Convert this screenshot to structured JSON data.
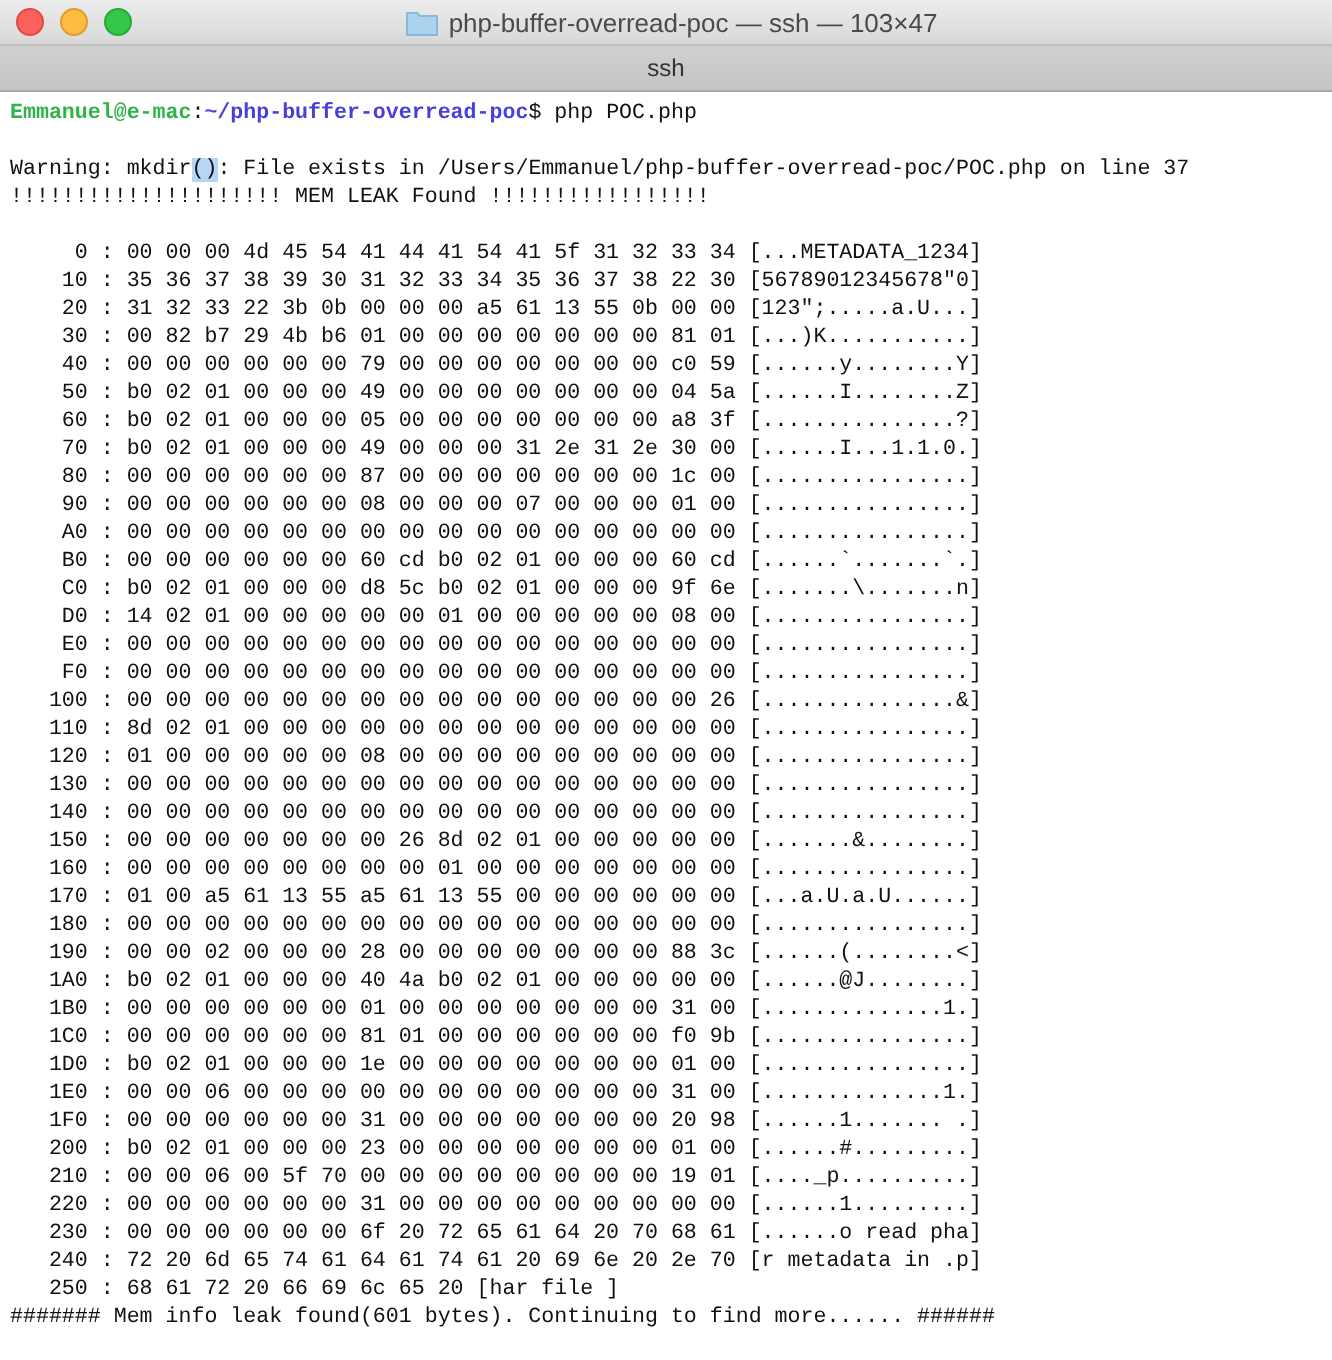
{
  "window": {
    "title": "php-buffer-overread-poc — ssh — 103×47"
  },
  "tab": {
    "label": "ssh"
  },
  "prompt": {
    "user_host": "Emmanuel@e-mac",
    "separator": ":",
    "path": "~/php-buffer-overread-poc",
    "command": "$ php POC.php"
  },
  "warning": [
    {
      "text": "Warning: mkdir",
      "selected": false
    },
    {
      "text": "()",
      "selected": true
    },
    {
      "text": ": File exists in /Users/Emmanuel/php-buffer-overread-poc/POC.php on line 37",
      "selected": false
    }
  ],
  "banner": "!!!!!!!!!!!!!!!!!!!!! MEM LEAK Found !!!!!!!!!!!!!!!!!",
  "dump": [
    "     0 : 00 00 00 4d 45 54 41 44 41 54 41 5f 31 32 33 34 [...METADATA_1234]",
    "    10 : 35 36 37 38 39 30 31 32 33 34 35 36 37 38 22 30 [56789012345678\"0]",
    "    20 : 31 32 33 22 3b 0b 00 00 00 a5 61 13 55 0b 00 00 [123\";.....a.U...]",
    "    30 : 00 82 b7 29 4b b6 01 00 00 00 00 00 00 00 81 01 [...)K...........]",
    "    40 : 00 00 00 00 00 00 79 00 00 00 00 00 00 00 c0 59 [......y........Y]",
    "    50 : b0 02 01 00 00 00 49 00 00 00 00 00 00 00 04 5a [......I........Z]",
    "    60 : b0 02 01 00 00 00 05 00 00 00 00 00 00 00 a8 3f [...............?]",
    "    70 : b0 02 01 00 00 00 49 00 00 00 31 2e 31 2e 30 00 [......I...1.1.0.]",
    "    80 : 00 00 00 00 00 00 87 00 00 00 00 00 00 00 1c 00 [................]",
    "    90 : 00 00 00 00 00 00 08 00 00 00 07 00 00 00 01 00 [................]",
    "    A0 : 00 00 00 00 00 00 00 00 00 00 00 00 00 00 00 00 [................]",
    "    B0 : 00 00 00 00 00 00 60 cd b0 02 01 00 00 00 60 cd [......`.......`.]",
    "    C0 : b0 02 01 00 00 00 d8 5c b0 02 01 00 00 00 9f 6e [.......\\.......n]",
    "    D0 : 14 02 01 00 00 00 00 00 01 00 00 00 00 00 08 00 [................]",
    "    E0 : 00 00 00 00 00 00 00 00 00 00 00 00 00 00 00 00 [................]",
    "    F0 : 00 00 00 00 00 00 00 00 00 00 00 00 00 00 00 00 [................]",
    "   100 : 00 00 00 00 00 00 00 00 00 00 00 00 00 00 00 26 [...............&]",
    "   110 : 8d 02 01 00 00 00 00 00 00 00 00 00 00 00 00 00 [................]",
    "   120 : 01 00 00 00 00 00 08 00 00 00 00 00 00 00 00 00 [................]",
    "   130 : 00 00 00 00 00 00 00 00 00 00 00 00 00 00 00 00 [................]",
    "   140 : 00 00 00 00 00 00 00 00 00 00 00 00 00 00 00 00 [................]",
    "   150 : 00 00 00 00 00 00 00 26 8d 02 01 00 00 00 00 00 [.......&........]",
    "   160 : 00 00 00 00 00 00 00 00 01 00 00 00 00 00 00 00 [................]",
    "   170 : 01 00 a5 61 13 55 a5 61 13 55 00 00 00 00 00 00 [...a.U.a.U......]",
    "   180 : 00 00 00 00 00 00 00 00 00 00 00 00 00 00 00 00 [................]",
    "   190 : 00 00 02 00 00 00 28 00 00 00 00 00 00 00 88 3c [......(........<]",
    "   1A0 : b0 02 01 00 00 00 40 4a b0 02 01 00 00 00 00 00 [......@J........]",
    "   1B0 : 00 00 00 00 00 00 01 00 00 00 00 00 00 00 31 00 [..............1.]",
    "   1C0 : 00 00 00 00 00 00 81 01 00 00 00 00 00 00 f0 9b [................]",
    "   1D0 : b0 02 01 00 00 00 1e 00 00 00 00 00 00 00 01 00 [................]",
    "   1E0 : 00 00 06 00 00 00 00 00 00 00 00 00 00 00 31 00 [..............1.]",
    "   1F0 : 00 00 00 00 00 00 31 00 00 00 00 00 00 00 20 98 [......1....... .]",
    "   200 : b0 02 01 00 00 00 23 00 00 00 00 00 00 00 01 00 [......#.........]",
    "   210 : 00 00 06 00 5f 70 00 00 00 00 00 00 00 00 19 01 [...._p..........]",
    "   220 : 00 00 00 00 00 00 31 00 00 00 00 00 00 00 00 00 [......1.........]",
    "   230 : 00 00 00 00 00 00 6f 20 72 65 61 64 20 70 68 61 [......o read pha]",
    "   240 : 72 20 6d 65 74 61 64 61 74 61 20 69 6e 20 2e 70 [r metadata in .p]",
    "   250 : 68 61 72 20 66 69 6c 65 20 [har file ]"
  ],
  "footer": "####### Mem info leak found(601 bytes). Continuing to find more...... ######"
}
